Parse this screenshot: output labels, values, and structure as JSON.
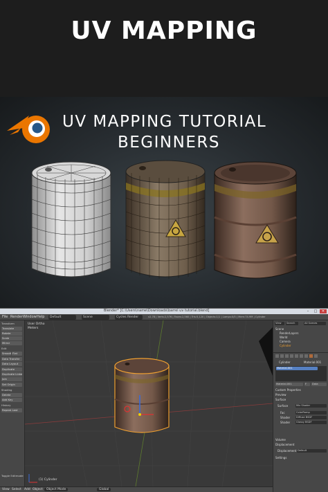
{
  "header": {
    "title": "UV MAPPING"
  },
  "banner": {
    "logo_icon": "blender-logo-icon",
    "line1": "UV MAPPING TUTORIAL",
    "line2": "BEGINNERS"
  },
  "blender": {
    "window_title": "Blender* [C:\\Users\\name\\Downloads\\barrel uv tutorial.blend]",
    "window_buttons": [
      "–",
      "□",
      "✕"
    ],
    "menu": [
      "File",
      "Render",
      "Window",
      "Help"
    ],
    "layout": "Default",
    "scene": "Scene",
    "engine": "Cycles Render",
    "stats": "v2.78 | Verts:2,576 | Faces:2,560 | Tris:5,120 | Objects:1/1 | Lamps:0/0 | Mem:74.9M | Cylinder",
    "viewport": {
      "view_label": "User Ortho",
      "units_label": "Meters",
      "object_label": "(1) Cylinder"
    },
    "bottom_bar": [
      "View",
      "Select",
      "Add",
      "Object",
      "Object Mode",
      "Global"
    ],
    "left_panel": {
      "header": "Transform",
      "buttons": [
        "Translate",
        "Rotate",
        "Scale",
        "Mirror",
        "Edit",
        "Smooth",
        "Flat",
        "Data Transfer",
        "Data Layout",
        "Duplicate",
        "Duplicate Linked",
        "Join",
        "Set Origin",
        "Shading",
        "Delete",
        "Add Key",
        "History",
        "Repeat Last"
      ],
      "footer": "Toggle Editmode"
    },
    "right_panel": {
      "tabs": [
        "View",
        "Search",
        "All Scenes"
      ],
      "outliner": [
        "Scene",
        "RenderLayers",
        "World",
        "Camera",
        "Cylinder"
      ],
      "breadcrumb": [
        "Cylinder",
        "Material.001"
      ],
      "material_slot": "Material.001",
      "material_buttons": [
        "Material.001",
        "F",
        "Data"
      ],
      "sections": [
        "Custom Properties",
        "Preview",
        "Surface"
      ],
      "fields": [
        {
          "label": "Surface",
          "value": "Mix Shader"
        },
        {
          "label": "Fac",
          "value": "ColorRamp"
        },
        {
          "label": "Shader",
          "value": "Diffuse BSDF"
        },
        {
          "label": "Shader",
          "value": "Glossy BSDF"
        }
      ],
      "sections2": [
        "Volume",
        "Displacement"
      ],
      "displacement": {
        "label": "Displacement",
        "value": "Default"
      },
      "settings": "Settings"
    }
  }
}
